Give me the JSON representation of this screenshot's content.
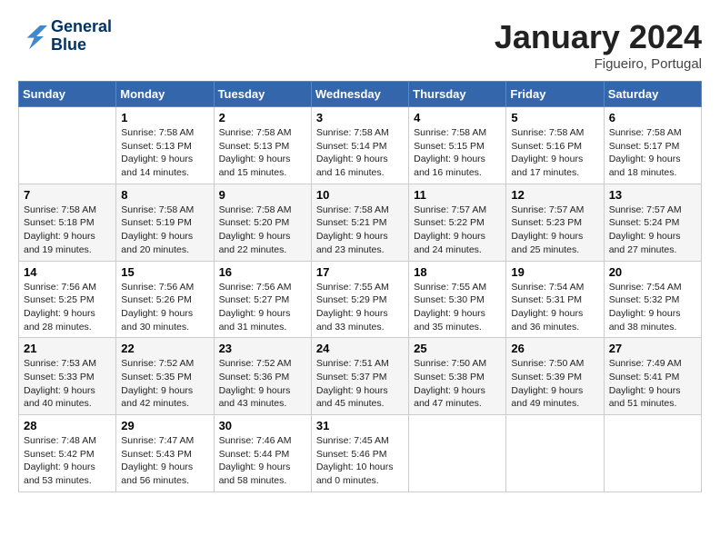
{
  "logo": {
    "line1": "General",
    "line2": "Blue"
  },
  "title": "January 2024",
  "location": "Figueiro, Portugal",
  "days_header": [
    "Sunday",
    "Monday",
    "Tuesday",
    "Wednesday",
    "Thursday",
    "Friday",
    "Saturday"
  ],
  "weeks": [
    [
      {
        "day": "",
        "info": ""
      },
      {
        "day": "1",
        "info": "Sunrise: 7:58 AM\nSunset: 5:13 PM\nDaylight: 9 hours\nand 14 minutes."
      },
      {
        "day": "2",
        "info": "Sunrise: 7:58 AM\nSunset: 5:13 PM\nDaylight: 9 hours\nand 15 minutes."
      },
      {
        "day": "3",
        "info": "Sunrise: 7:58 AM\nSunset: 5:14 PM\nDaylight: 9 hours\nand 16 minutes."
      },
      {
        "day": "4",
        "info": "Sunrise: 7:58 AM\nSunset: 5:15 PM\nDaylight: 9 hours\nand 16 minutes."
      },
      {
        "day": "5",
        "info": "Sunrise: 7:58 AM\nSunset: 5:16 PM\nDaylight: 9 hours\nand 17 minutes."
      },
      {
        "day": "6",
        "info": "Sunrise: 7:58 AM\nSunset: 5:17 PM\nDaylight: 9 hours\nand 18 minutes."
      }
    ],
    [
      {
        "day": "7",
        "info": "Sunrise: 7:58 AM\nSunset: 5:18 PM\nDaylight: 9 hours\nand 19 minutes."
      },
      {
        "day": "8",
        "info": "Sunrise: 7:58 AM\nSunset: 5:19 PM\nDaylight: 9 hours\nand 20 minutes."
      },
      {
        "day": "9",
        "info": "Sunrise: 7:58 AM\nSunset: 5:20 PM\nDaylight: 9 hours\nand 22 minutes."
      },
      {
        "day": "10",
        "info": "Sunrise: 7:58 AM\nSunset: 5:21 PM\nDaylight: 9 hours\nand 23 minutes."
      },
      {
        "day": "11",
        "info": "Sunrise: 7:57 AM\nSunset: 5:22 PM\nDaylight: 9 hours\nand 24 minutes."
      },
      {
        "day": "12",
        "info": "Sunrise: 7:57 AM\nSunset: 5:23 PM\nDaylight: 9 hours\nand 25 minutes."
      },
      {
        "day": "13",
        "info": "Sunrise: 7:57 AM\nSunset: 5:24 PM\nDaylight: 9 hours\nand 27 minutes."
      }
    ],
    [
      {
        "day": "14",
        "info": "Sunrise: 7:56 AM\nSunset: 5:25 PM\nDaylight: 9 hours\nand 28 minutes."
      },
      {
        "day": "15",
        "info": "Sunrise: 7:56 AM\nSunset: 5:26 PM\nDaylight: 9 hours\nand 30 minutes."
      },
      {
        "day": "16",
        "info": "Sunrise: 7:56 AM\nSunset: 5:27 PM\nDaylight: 9 hours\nand 31 minutes."
      },
      {
        "day": "17",
        "info": "Sunrise: 7:55 AM\nSunset: 5:29 PM\nDaylight: 9 hours\nand 33 minutes."
      },
      {
        "day": "18",
        "info": "Sunrise: 7:55 AM\nSunset: 5:30 PM\nDaylight: 9 hours\nand 35 minutes."
      },
      {
        "day": "19",
        "info": "Sunrise: 7:54 AM\nSunset: 5:31 PM\nDaylight: 9 hours\nand 36 minutes."
      },
      {
        "day": "20",
        "info": "Sunrise: 7:54 AM\nSunset: 5:32 PM\nDaylight: 9 hours\nand 38 minutes."
      }
    ],
    [
      {
        "day": "21",
        "info": "Sunrise: 7:53 AM\nSunset: 5:33 PM\nDaylight: 9 hours\nand 40 minutes."
      },
      {
        "day": "22",
        "info": "Sunrise: 7:52 AM\nSunset: 5:35 PM\nDaylight: 9 hours\nand 42 minutes."
      },
      {
        "day": "23",
        "info": "Sunrise: 7:52 AM\nSunset: 5:36 PM\nDaylight: 9 hours\nand 43 minutes."
      },
      {
        "day": "24",
        "info": "Sunrise: 7:51 AM\nSunset: 5:37 PM\nDaylight: 9 hours\nand 45 minutes."
      },
      {
        "day": "25",
        "info": "Sunrise: 7:50 AM\nSunset: 5:38 PM\nDaylight: 9 hours\nand 47 minutes."
      },
      {
        "day": "26",
        "info": "Sunrise: 7:50 AM\nSunset: 5:39 PM\nDaylight: 9 hours\nand 49 minutes."
      },
      {
        "day": "27",
        "info": "Sunrise: 7:49 AM\nSunset: 5:41 PM\nDaylight: 9 hours\nand 51 minutes."
      }
    ],
    [
      {
        "day": "28",
        "info": "Sunrise: 7:48 AM\nSunset: 5:42 PM\nDaylight: 9 hours\nand 53 minutes."
      },
      {
        "day": "29",
        "info": "Sunrise: 7:47 AM\nSunset: 5:43 PM\nDaylight: 9 hours\nand 56 minutes."
      },
      {
        "day": "30",
        "info": "Sunrise: 7:46 AM\nSunset: 5:44 PM\nDaylight: 9 hours\nand 58 minutes."
      },
      {
        "day": "31",
        "info": "Sunrise: 7:45 AM\nSunset: 5:46 PM\nDaylight: 10 hours\nand 0 minutes."
      },
      {
        "day": "",
        "info": ""
      },
      {
        "day": "",
        "info": ""
      },
      {
        "day": "",
        "info": ""
      }
    ]
  ]
}
